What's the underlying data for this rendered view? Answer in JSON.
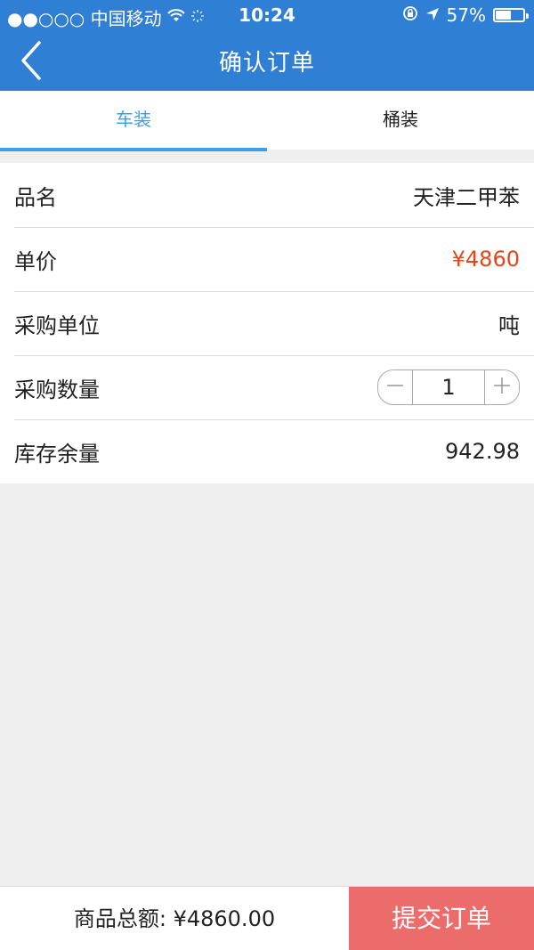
{
  "status_bar": {
    "carrier": "●●○○○ 中国移动",
    "wifi_icon": "wifi-icon",
    "time": "10:24",
    "battery_percent": "57%",
    "battery_level": 0.57
  },
  "nav": {
    "back_icon": "chevron-left-icon",
    "title": "确认订单"
  },
  "tabs": [
    {
      "label": "车装",
      "active": true
    },
    {
      "label": "桶装",
      "active": false
    }
  ],
  "rows": {
    "product_name": {
      "label": "品名",
      "value": "天津二甲苯"
    },
    "unit_price": {
      "label": "单价",
      "value": "¥4860"
    },
    "purchase_unit": {
      "label": "采购单位",
      "value": "吨"
    },
    "quantity": {
      "label": "采购数量",
      "value": "1"
    },
    "stock": {
      "label": "库存余量",
      "value": "942.98"
    }
  },
  "bottom": {
    "total_text": "商品总额: ¥4860.00",
    "submit_label": "提交订单"
  },
  "colors": {
    "header": "#2f7fd4",
    "tab_active": "#3d9ee9",
    "price": "#e8441a",
    "submit": "#ec6b6b"
  }
}
